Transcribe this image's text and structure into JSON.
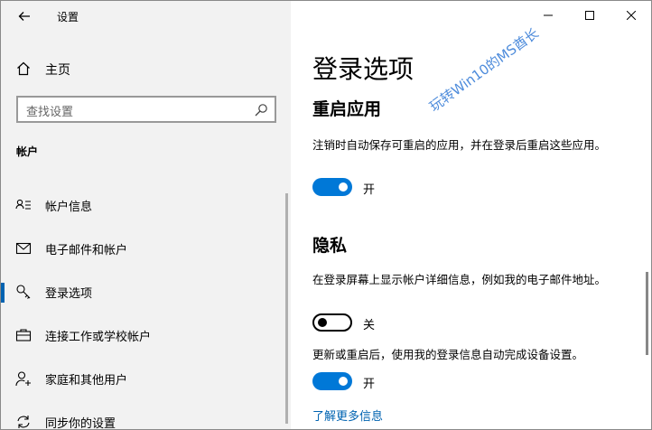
{
  "window": {
    "app_title": "设置"
  },
  "sidebar": {
    "home_label": "主页",
    "search_placeholder": "查找设置",
    "section_title": "帐户",
    "items": [
      {
        "label": "帐户信息",
        "icon": "account-info-icon",
        "selected": false
      },
      {
        "label": "电子邮件和帐户",
        "icon": "mail-icon",
        "selected": false
      },
      {
        "label": "登录选项",
        "icon": "key-icon",
        "selected": true
      },
      {
        "label": "连接工作或学校帐户",
        "icon": "briefcase-icon",
        "selected": false
      },
      {
        "label": "家庭和其他用户",
        "icon": "person-add-icon",
        "selected": false
      },
      {
        "label": "同步你的设置",
        "icon": "sync-icon",
        "selected": false
      }
    ]
  },
  "main": {
    "page_title": "登录选项",
    "restart_apps": {
      "heading": "重启应用",
      "description": "注销时自动保存可重启的应用，并在登录后重启这些应用。",
      "toggle_on": true,
      "state_label": "开"
    },
    "privacy": {
      "heading": "隐私",
      "show_account_details": {
        "description": "在登录屏幕上显示帐户详细信息，例如我的电子邮件地址。",
        "toggle_on": false,
        "state_label": "关"
      },
      "use_signin_info": {
        "description": "更新或重启后，使用我的登录信息自动完成设备设置。",
        "toggle_on": true,
        "state_label": "开"
      }
    },
    "learn_more_link": "了解更多信息"
  },
  "watermark": "玩转Win10的MS酋长",
  "colors": {
    "accent": "#0078d7",
    "link": "#0063b1",
    "sidebar_bg": "#f2f2f2",
    "watermark": "#3a7fd8"
  }
}
